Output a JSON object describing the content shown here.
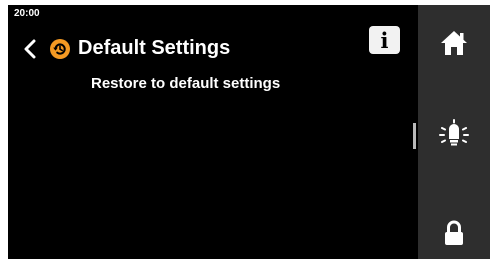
{
  "status_bar": {
    "time": "20:00"
  },
  "header": {
    "title": "Default Settings",
    "info_label": "i"
  },
  "main": {
    "subtitle": "Restore to default settings"
  },
  "colors": {
    "background": "#000000",
    "sidebar": "#2e2e2e",
    "accent": "#f59a23",
    "text": "#ffffff"
  },
  "icons": {
    "back": "chevron-left-icon",
    "title": "restore-icon",
    "home": "home-icon",
    "light": "light-bulb-icon",
    "lock": "lock-icon"
  }
}
